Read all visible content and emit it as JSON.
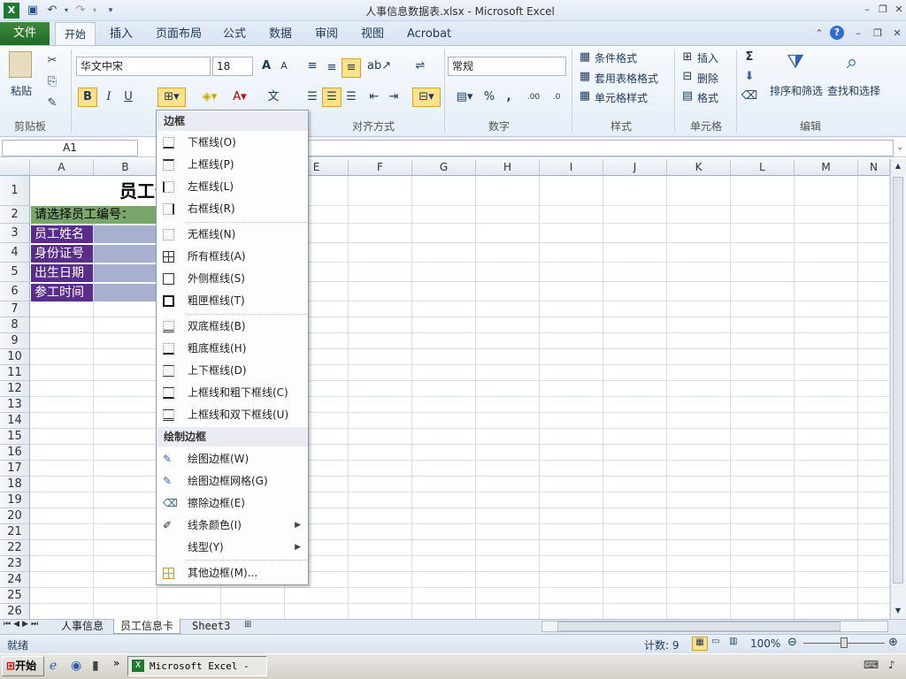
{
  "window": {
    "title": "人事信息数据表.xlsx  -  Microsoft Excel"
  },
  "tabs": {
    "file": "文件",
    "home": "开始",
    "insert": "插入",
    "page_layout": "页面布局",
    "formulas": "公式",
    "data": "数据",
    "review": "审阅",
    "view": "视图",
    "acrobat": "Acrobat"
  },
  "ribbon": {
    "clipboard": {
      "paste": "粘贴",
      "label": "剪贴板"
    },
    "font": {
      "name": "华文中宋",
      "size": "18",
      "bold": "B",
      "italic": "I",
      "underline": "U"
    },
    "alignment": {
      "label": "对齐方式"
    },
    "number": {
      "format": "常规",
      "label": "数字",
      "percent": "%",
      "comma": ","
    },
    "styles": {
      "conditional": "条件格式",
      "table": "套用表格格式",
      "cell_styles": "单元格样式",
      "label": "样式"
    },
    "cells": {
      "insert": "插入",
      "delete": "删除",
      "format": "格式",
      "label": "单元格"
    },
    "editing": {
      "sigma": "Σ",
      "sort": "排序和筛选",
      "find": "查找和选择",
      "label": "编辑"
    }
  },
  "namebox": {
    "value": "A1"
  },
  "columns": [
    "A",
    "B",
    "C",
    "D",
    "E",
    "F",
    "G",
    "H",
    "I",
    "J",
    "K",
    "L",
    "M",
    "N"
  ],
  "rows": [
    "1",
    "2",
    "3",
    "4",
    "5",
    "6",
    "7",
    "8",
    "9",
    "10",
    "11",
    "12",
    "13",
    "14",
    "15",
    "16",
    "17",
    "18",
    "19",
    "20",
    "21",
    "22",
    "23",
    "24",
    "25",
    "26"
  ],
  "cells": {
    "title": "员工信",
    "prompt": "请选择员工编号：",
    "labels": [
      "员工姓名",
      "身份证号",
      "出生日期",
      "参工时间"
    ]
  },
  "border_menu": {
    "header": "边框",
    "items": [
      "下框线(O)",
      "上框线(P)",
      "左框线(L)",
      "右框线(R)",
      "无框线(N)",
      "所有框线(A)",
      "外侧框线(S)",
      "粗匣框线(T)",
      "双底框线(B)",
      "粗底框线(H)",
      "上下框线(D)",
      "上框线和粗下框线(C)",
      "上框线和双下框线(U)"
    ],
    "draw_header": "绘制边框",
    "draw_items": [
      "绘图边框(W)",
      "绘图边框网格(G)",
      "擦除边框(E)",
      "线条颜色(I)",
      "线型(Y)",
      "其他边框(M)..."
    ]
  },
  "sheets": [
    "人事信息",
    "员工信息卡",
    "Sheet3"
  ],
  "status": {
    "ready": "就绪",
    "count": "计数: 9",
    "zoom": "100%"
  },
  "taskbar": {
    "start": "开始",
    "app": "Microsoft Excel - ..."
  },
  "colors": {
    "file_tab": "#2a7a32",
    "label_cells": "#5a2d8c",
    "prompt_cell": "#7aa66b",
    "value_cells": "#a8b0cf",
    "selected_button": "#fde28d"
  }
}
